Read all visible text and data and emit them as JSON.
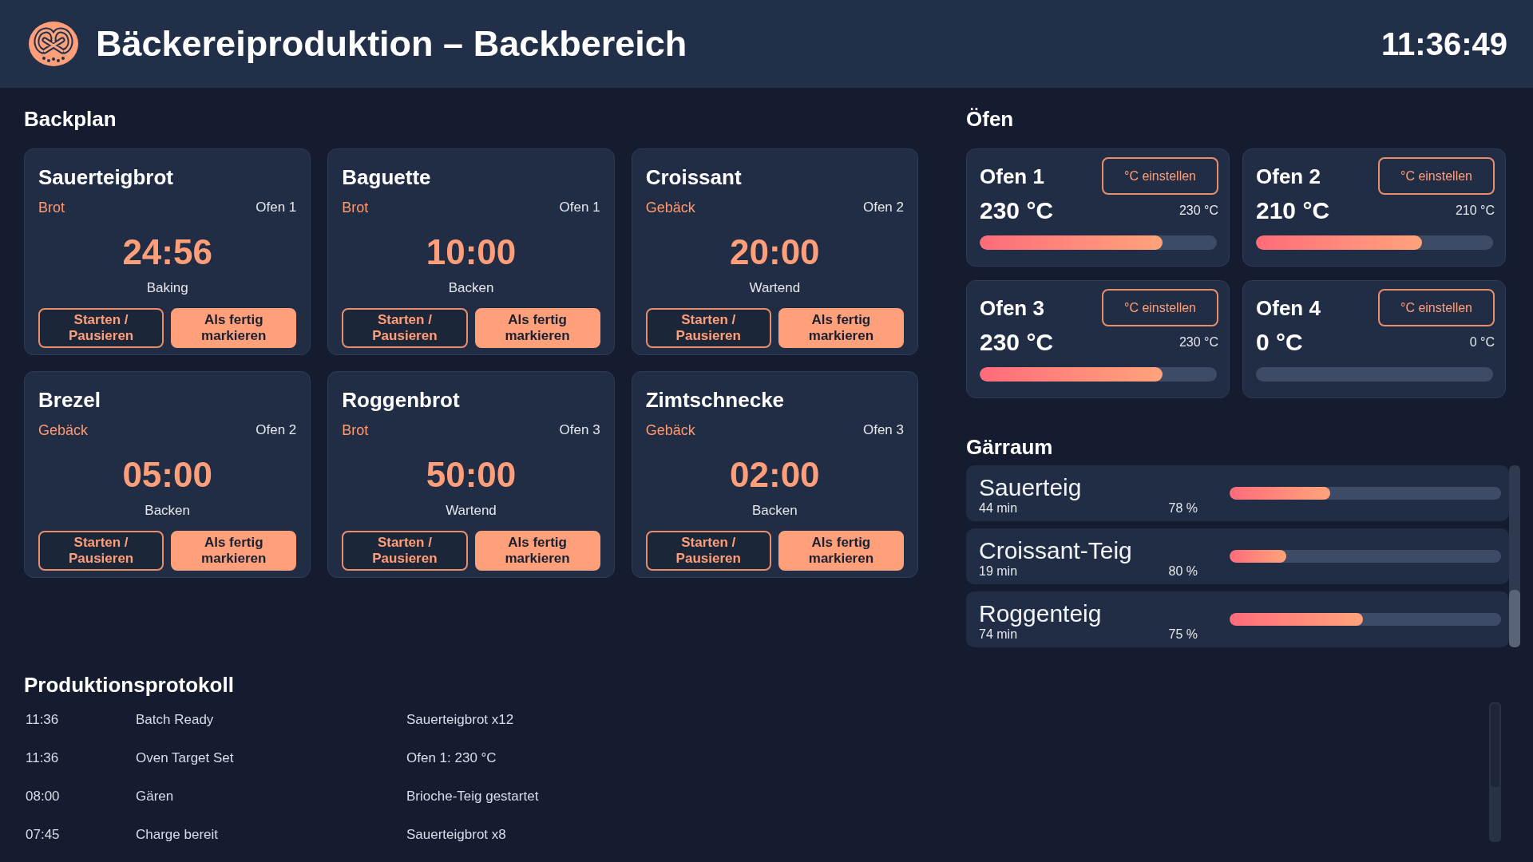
{
  "header": {
    "title": "Bäckereiproduktion – Backbereich",
    "clock": "11:36:49"
  },
  "backplan": {
    "title": "Backplan",
    "batches": [
      {
        "name": "Sauerteigbrot",
        "category": "Brot",
        "oven": "Ofen 1",
        "timer": "24:56",
        "status": "Baking",
        "buttons": [
          {
            "label": "Starten / Pausieren",
            "kind": "outline"
          },
          {
            "label": "Als fertig markieren",
            "kind": "filled"
          }
        ]
      },
      {
        "name": "Baguette",
        "category": "Brot",
        "oven": "Ofen 1",
        "timer": "10:00",
        "status": "Backen",
        "buttons": [
          {
            "label": "Starten / Pausieren",
            "kind": "outline"
          },
          {
            "label": "Als fertig markieren",
            "kind": "filled"
          }
        ]
      },
      {
        "name": "Croissant",
        "category": "Gebäck",
        "oven": "Ofen 2",
        "timer": "20:00",
        "status": "Wartend",
        "buttons": [
          {
            "label": "Starten / Pausieren",
            "kind": "outline"
          },
          {
            "label": "Als fertig markieren",
            "kind": "filled"
          }
        ]
      },
      {
        "name": "Brezel",
        "category": "Gebäck",
        "oven": "Ofen 2",
        "timer": "05:00",
        "status": "Backen",
        "buttons": [
          {
            "label": "Starten / Pausieren",
            "kind": "outline"
          },
          {
            "label": "Als fertig markieren",
            "kind": "filled"
          }
        ]
      },
      {
        "name": "Roggenbrot",
        "category": "Brot",
        "oven": "Ofen 3",
        "timer": "50:00",
        "status": "Wartend",
        "buttons": [
          {
            "label": "Starten / Pausieren",
            "kind": "outline"
          },
          {
            "label": "Als fertig markieren",
            "kind": "filled"
          }
        ]
      },
      {
        "name": "Zimtschnecke",
        "category": "Gebäck",
        "oven": "Ofen 3",
        "timer": "02:00",
        "status": "Backen",
        "buttons": [
          {
            "label": "Starten / Pausieren",
            "kind": "outline"
          },
          {
            "label": "Als fertig markieren",
            "kind": "filled"
          }
        ]
      }
    ]
  },
  "ovens": {
    "title": "Öfen",
    "items": [
      {
        "name": "Ofen 1",
        "button": "°C einstellen",
        "temperature": "230 °C",
        "target": "230 °C",
        "level": 0.77
      },
      {
        "name": "Ofen 2",
        "button": "°C einstellen",
        "temperature": "210 °C",
        "target": "210 °C",
        "level": 0.7
      },
      {
        "name": "Ofen 3",
        "button": "°C einstellen",
        "temperature": "230 °C",
        "target": "230 °C",
        "level": 0.77
      },
      {
        "name": "Ofen 4",
        "button": "°C einstellen",
        "temperature": "0 °C",
        "target": "0 °C"
      }
    ]
  },
  "proofing": {
    "title": "Gärraum",
    "items": [
      {
        "name": "Sauerteig",
        "time": "44 min",
        "percent": "78 %",
        "level": 0.37
      },
      {
        "name": "Croissant-Teig",
        "time": "19 min",
        "percent": "80 %",
        "level": 0.21
      },
      {
        "name": "Roggenteig",
        "time": "74 min",
        "percent": "75 %",
        "level": 0.49
      }
    ]
  },
  "log": {
    "title": "Produktionsprotokoll",
    "rows": [
      {
        "time": "11:36",
        "event": "Batch Ready",
        "detail": "Sauerteigbrot x12"
      },
      {
        "time": "11:36",
        "event": "Oven Target Set",
        "detail": "Ofen 1: 230 °C"
      },
      {
        "time": "08:00",
        "event": "Gären",
        "detail": "Brioche-Teig gestartet"
      },
      {
        "time": "07:45",
        "event": "Charge bereit",
        "detail": "Sauerteigbrot x8"
      }
    ]
  }
}
